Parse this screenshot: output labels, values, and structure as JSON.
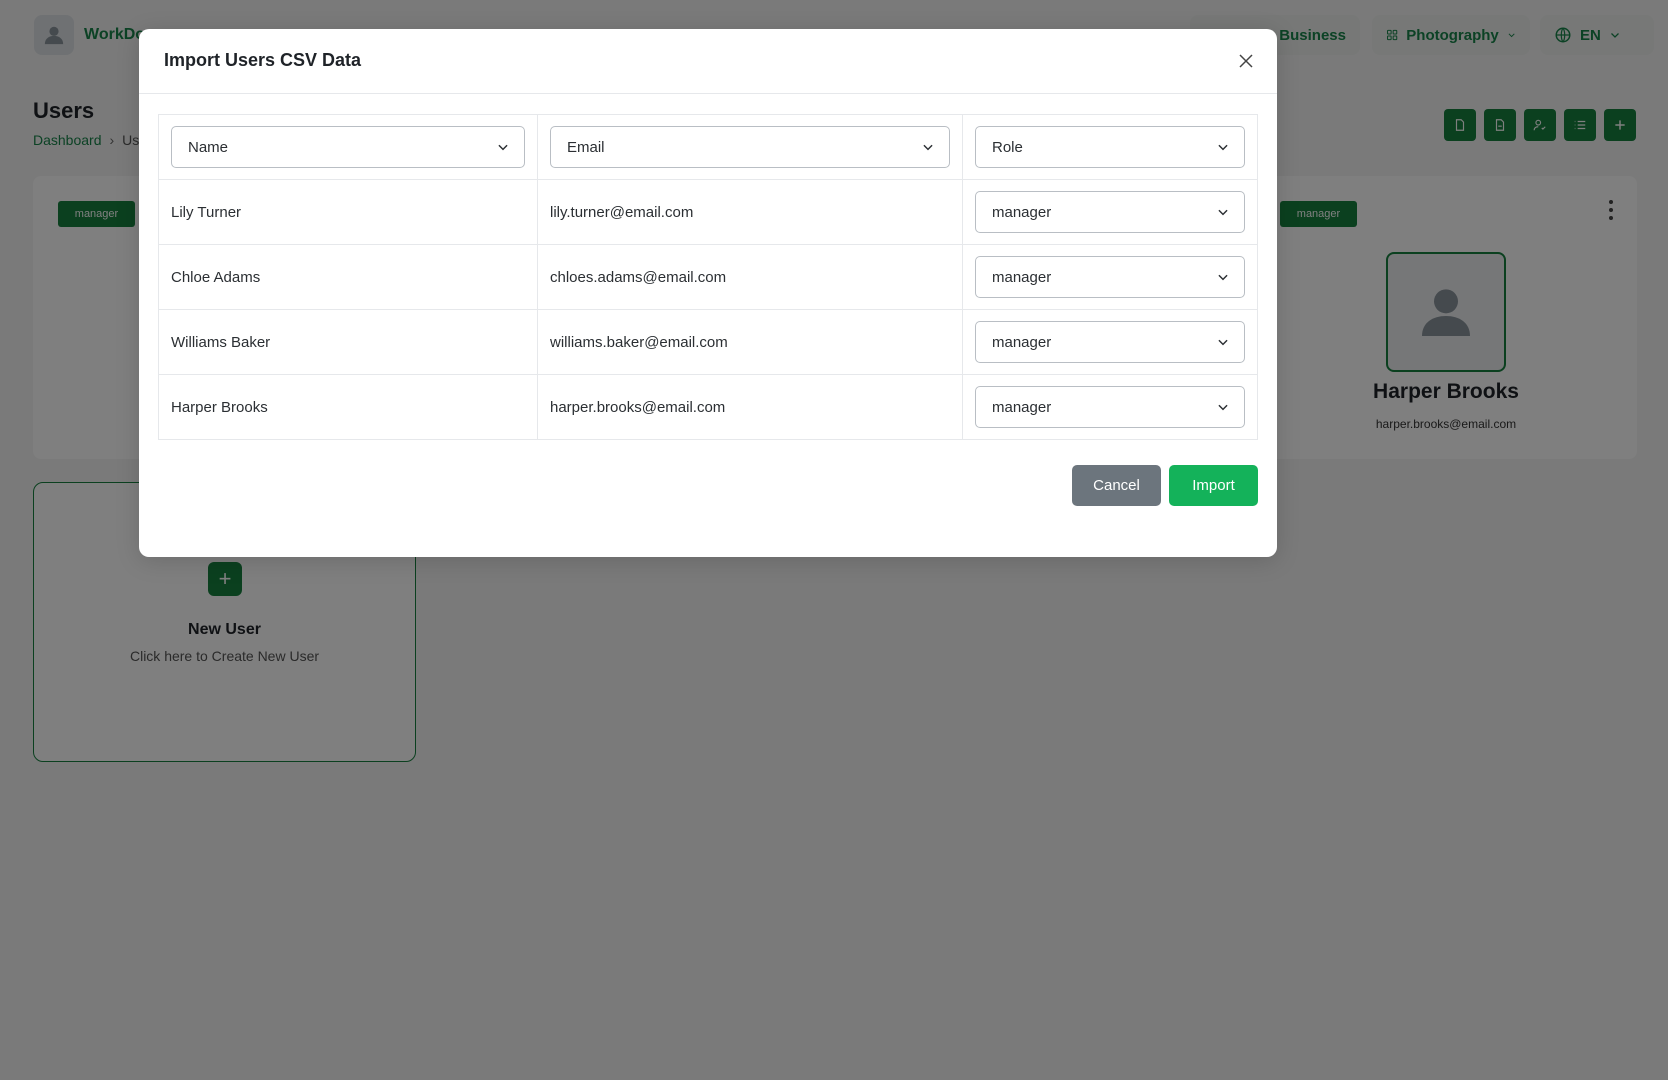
{
  "app": {
    "brand_name": "WorkDo",
    "business_label": "Create Business",
    "category_label": "Photography",
    "language_label": "EN"
  },
  "page": {
    "title": "Users",
    "breadcrumb": [
      "Dashboard",
      "Users"
    ]
  },
  "user_cards": {
    "badge_left": "manager",
    "badge_right": "manager",
    "visible_user": {
      "name": "Harper Brooks",
      "email": "harper.brooks@email.com"
    }
  },
  "new_user_card": {
    "title": "New User",
    "subtitle": "Click here to Create New User"
  },
  "modal": {
    "title": "Import Users CSV Data",
    "column_mappings": [
      "Name",
      "Email",
      "Role"
    ],
    "rows": [
      {
        "name": "Lily Turner",
        "email": "lily.turner@email.com",
        "role": "manager"
      },
      {
        "name": "Chloe Adams",
        "email": "chloes.adams@email.com",
        "role": "manager"
      },
      {
        "name": "Williams Baker",
        "email": "williams.baker@email.com",
        "role": "manager"
      },
      {
        "name": "Harper Brooks",
        "email": "harper.brooks@email.com",
        "role": "manager"
      }
    ],
    "cancel_label": "Cancel",
    "import_label": "Import"
  },
  "colors": {
    "primary_green": "#16803f",
    "import_green": "#14b25a",
    "cancel_gray": "#6c757d"
  },
  "icons": {
    "close": "close-icon",
    "chevron": "chevron-down-icon",
    "user": "user-icon",
    "plus": "plus-icon"
  }
}
